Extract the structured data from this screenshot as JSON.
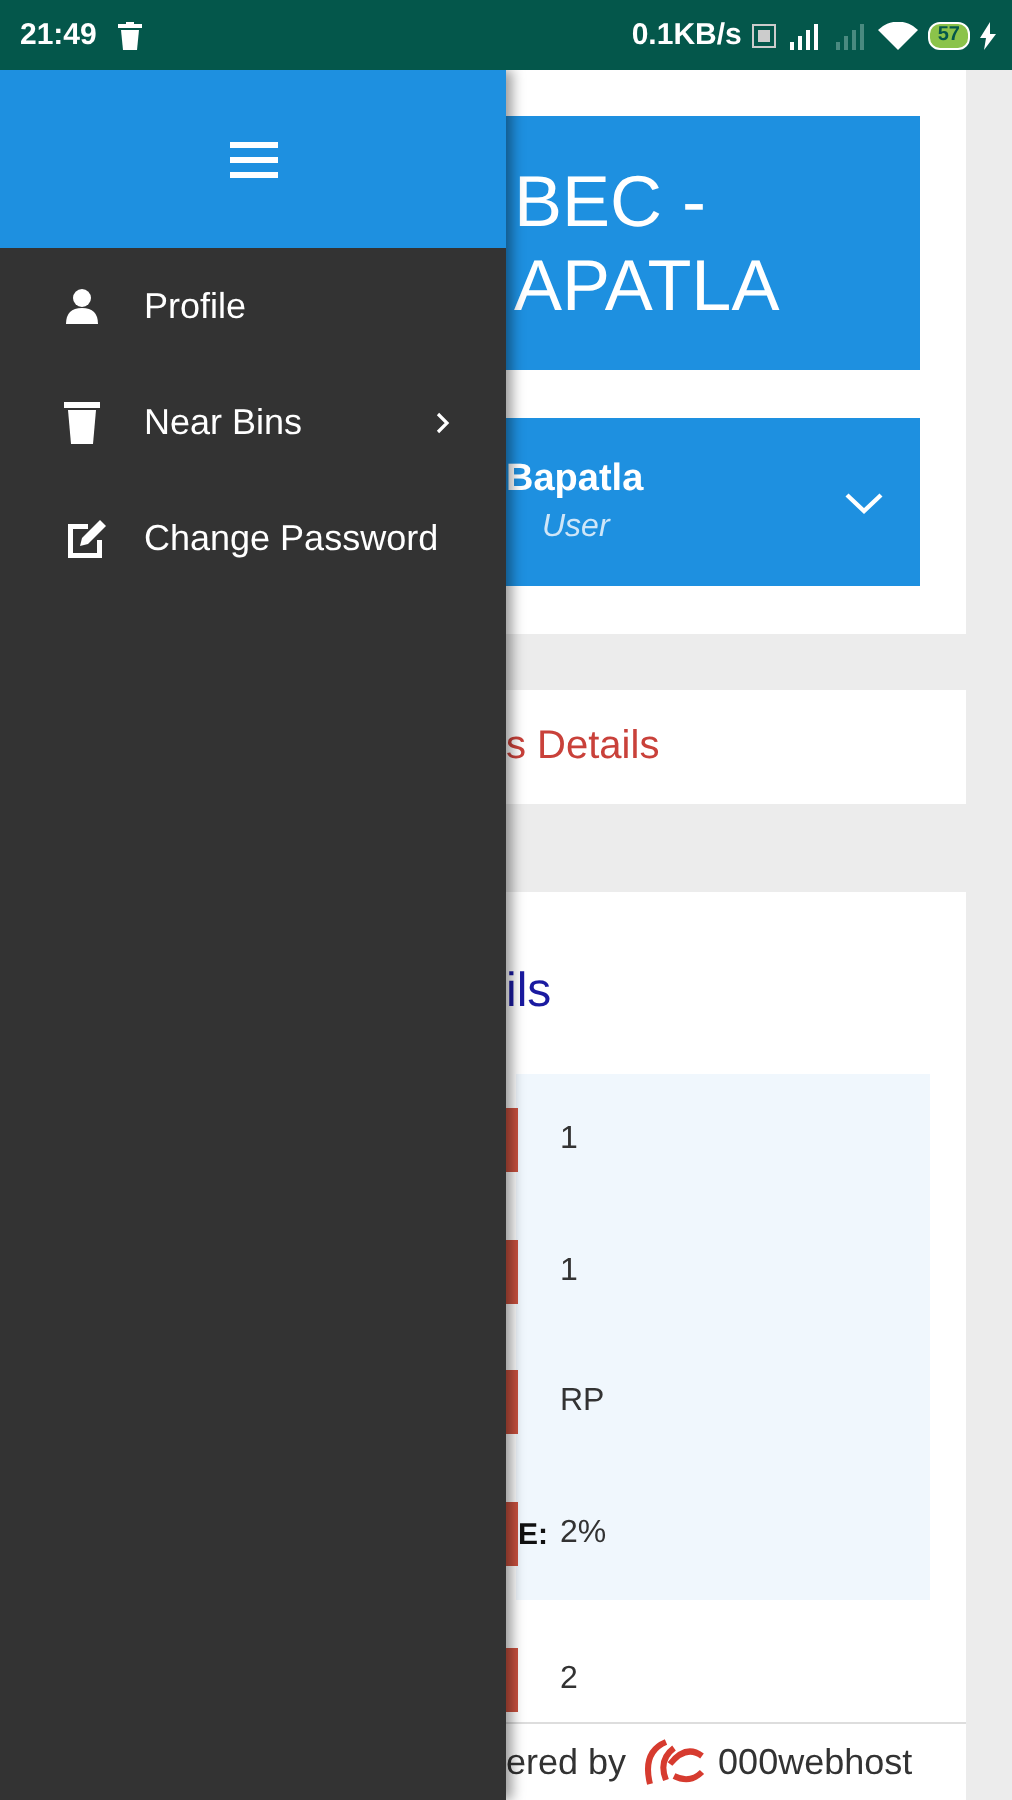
{
  "status_bar": {
    "time": "21:49",
    "speed": "0.1KB/s",
    "battery": "57",
    "charging": true
  },
  "drawer": {
    "items": [
      {
        "label": "Profile",
        "has_submenu": false
      },
      {
        "label": "Near Bins",
        "has_submenu": true
      },
      {
        "label": "Change Password",
        "has_submenu": false
      }
    ]
  },
  "main": {
    "title_lines": [
      "BEC -",
      "APATLA"
    ],
    "user_name": "Bapatla",
    "user_role": "User",
    "details_link": "s Details",
    "section_title": "ils",
    "rows": [
      {
        "value": "1"
      },
      {
        "value": "1"
      },
      {
        "value": "RP"
      },
      {
        "label": "E:",
        "value": "2%"
      }
    ],
    "next_value": "2"
  },
  "footer": {
    "prefix": "ered by",
    "brand": "000webhost"
  }
}
